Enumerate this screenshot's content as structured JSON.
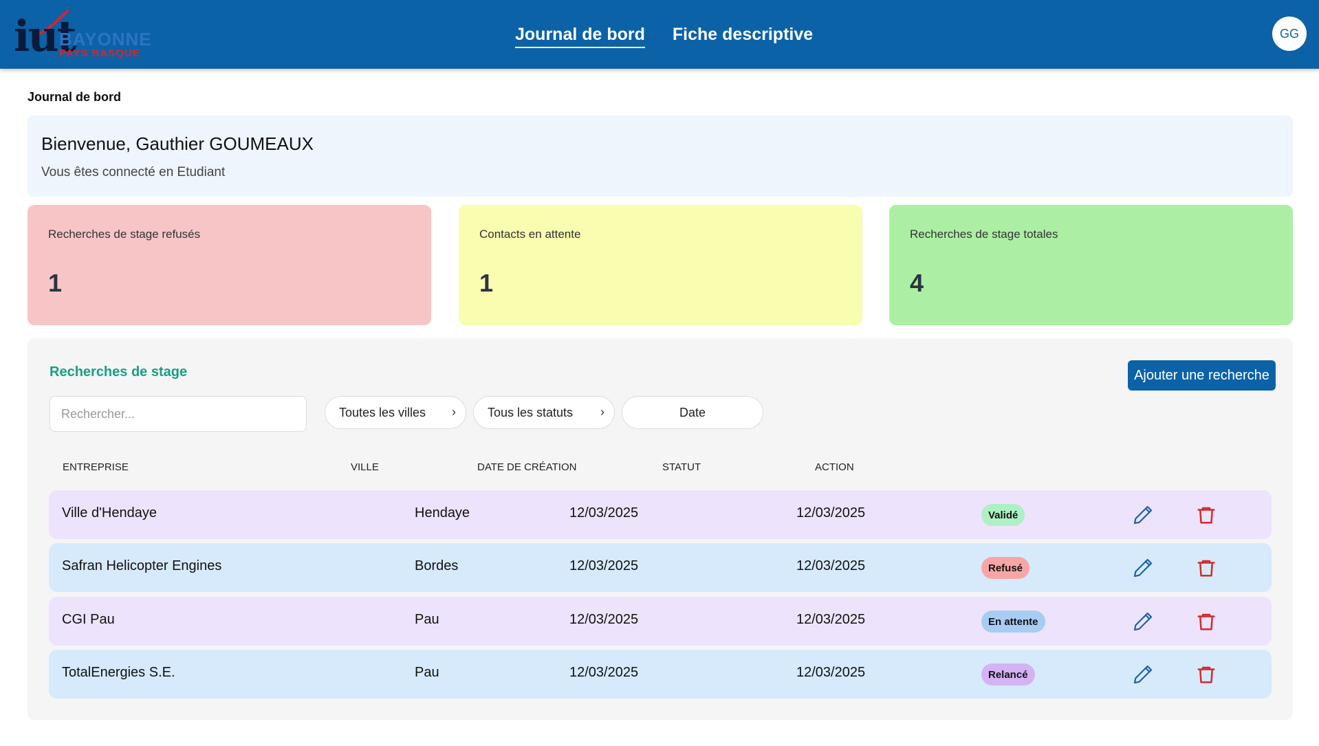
{
  "header": {
    "logo": {
      "main": "iut",
      "line1": "BAYONNE",
      "line2": "PAYS BASQUE"
    },
    "nav": [
      {
        "label": "Journal de bord",
        "active": true
      },
      {
        "label": "Fiche descriptive",
        "active": false
      }
    ],
    "avatar_initials": "GG"
  },
  "page_title": "Journal de bord",
  "welcome": {
    "title": "Bienvenue, Gauthier GOUMEAUX",
    "subtitle": "Vous êtes connecté en Etudiant"
  },
  "stats": {
    "refused": {
      "label": "Recherches de stage refusés",
      "value": "1"
    },
    "pending": {
      "label": "Contacts en attente",
      "value": "1"
    },
    "total": {
      "label": "Recherches de stage totales",
      "value": "4"
    }
  },
  "searches": {
    "title": "Recherches de stage",
    "add_button": "Ajouter une recherche",
    "search_placeholder": "Rechercher...",
    "filters": {
      "city": "Toutes les villes",
      "status": "Tous les statuts",
      "date": "Date"
    },
    "columns": [
      "Entreprise",
      "Ville",
      "Date de création",
      "Statut",
      "Action"
    ],
    "rows": [
      {
        "company": "Ville d'Hendaye",
        "city": "Hendaye",
        "created": "12/03/2025",
        "status_date": "12/03/2025",
        "badge": "Validé"
      },
      {
        "company": "Safran Helicopter Engines",
        "city": "Bordes",
        "created": "12/03/2025",
        "status_date": "12/03/2025",
        "badge": "Refusé"
      },
      {
        "company": "CGI Pau",
        "city": "Pau",
        "created": "12/03/2025",
        "status_date": "12/03/2025",
        "badge": "En attente"
      },
      {
        "company": "TotalEnergies S.E.",
        "city": "Pau",
        "created": "12/03/2025",
        "status_date": "12/03/2025",
        "badge": "Relancé"
      }
    ]
  },
  "colors": {
    "header_bg": "#0b62a7",
    "accent_green": "#16a085",
    "refused_card": "#f7c5c6",
    "pending_card": "#f8fdb0",
    "total_card": "#acefa4",
    "row_purple": "#ede3fc",
    "row_blue": "#d6eafc",
    "edit_icon": "#1a5fa8",
    "delete_icon": "#d42a2a"
  },
  "icons": {
    "edit": "pencil-icon",
    "delete": "trash-icon",
    "dropdown": "chevron-right-icon"
  }
}
